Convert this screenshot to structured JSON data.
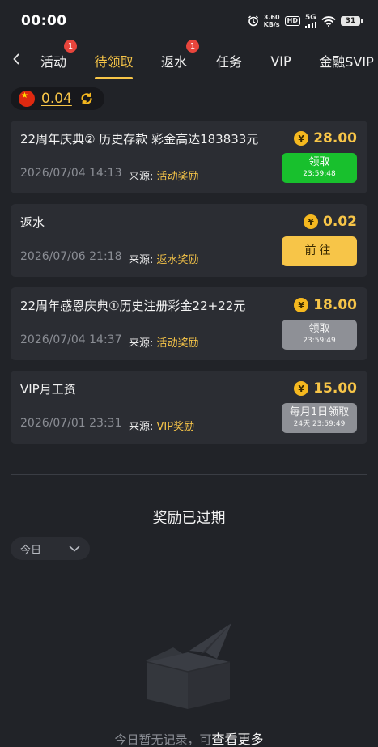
{
  "status_bar": {
    "time": "00:00",
    "speed_value": "3.60",
    "speed_unit": "KB/s",
    "hd_label": "HD",
    "network_label": "5G",
    "battery_level": "31"
  },
  "tabs": [
    {
      "label": "活动",
      "badge": "1",
      "active": false
    },
    {
      "label": "待领取",
      "badge": "",
      "active": true
    },
    {
      "label": "返水",
      "badge": "1",
      "active": false
    },
    {
      "label": "任务",
      "badge": "",
      "active": false
    },
    {
      "label": "VIP",
      "badge": "",
      "active": false
    },
    {
      "label": "金融SVIP",
      "badge": "",
      "active": false
    }
  ],
  "balance": {
    "amount": "0.04"
  },
  "cards": [
    {
      "title": "22周年庆典② 历史存款 彩金高达183833元",
      "amount": "28.00",
      "date": "2026/07/04 14:13",
      "source_label": "来源: ",
      "source_value": "活动奖励",
      "button_label": "领取",
      "button_countdown": "23:59:48",
      "button_style": "green"
    },
    {
      "title": "返水",
      "amount": "0.02",
      "date": "2026/07/06 21:18",
      "source_label": "来源: ",
      "source_value": "返水奖励",
      "button_label": "前往",
      "button_countdown": "",
      "button_style": "orange"
    },
    {
      "title": "22周年感恩庆典①历史注册彩金22+22元",
      "amount": "18.00",
      "date": "2026/07/04 14:37",
      "source_label": "来源: ",
      "source_value": "活动奖励",
      "button_label": "领取",
      "button_countdown": "23:59:49",
      "button_style": "gray"
    },
    {
      "title": "VIP月工资",
      "amount": "15.00",
      "date": "2026/07/01 23:31",
      "source_label": "来源: ",
      "source_value": "VIP奖励",
      "button_label": "每月1日领取",
      "button_countdown": "24天 23:59:49",
      "button_style": "gray"
    }
  ],
  "expired": {
    "title": "奖励已过期",
    "filter_value": "今日",
    "empty_text": "今日暂无记录，可",
    "more_link": "查看更多"
  },
  "icons": {
    "yen_symbol": "¥",
    "accent_color": "#f7c548"
  }
}
